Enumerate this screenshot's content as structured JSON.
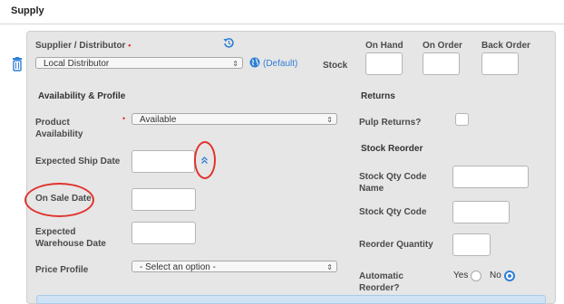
{
  "section": {
    "title": "Supply"
  },
  "supplier": {
    "label": "Supplier / Distributor",
    "required": "•",
    "value": "Local Distributor",
    "default_text": "(Default)"
  },
  "stock": {
    "label": "Stock",
    "on_hand": "On Hand",
    "on_order": "On Order",
    "back_order": "Back Order"
  },
  "availability": {
    "header": "Availability & Profile",
    "product_availability_label": "Product Availability",
    "required": "•",
    "product_availability_value": "Available",
    "expected_ship_label": "Expected Ship Date",
    "on_sale_label": "On Sale Date",
    "expected_warehouse_label": "Expected Warehouse Date",
    "price_profile_label": "Price Profile",
    "price_profile_value": "- Select an option -"
  },
  "returns": {
    "header": "Returns",
    "pulp_returns_label": "Pulp Returns?"
  },
  "reorder": {
    "header": "Stock Reorder",
    "code_name_label": "Stock Qty Code Name",
    "code_label": "Stock Qty Code",
    "quantity_label": "Reorder Quantity",
    "automatic_label": "Automatic Reorder?",
    "yes": "Yes",
    "no": "No",
    "selected": "No"
  },
  "icons": {
    "delete": "trash-icon",
    "reset": "reset-icon",
    "globe": "globe-icon",
    "collapse": "double-chevron-up-icon"
  },
  "colors": {
    "accent": "#2f7fd6",
    "annotation": "#e0342c"
  }
}
